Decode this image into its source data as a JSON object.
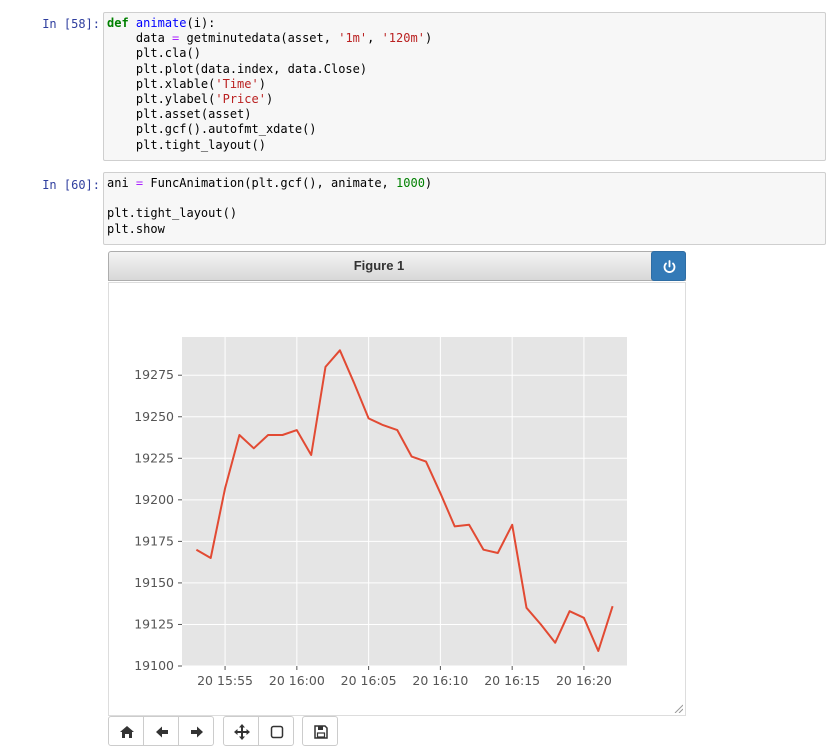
{
  "cell1": {
    "prompt": "In [58]:",
    "code_lines": [
      "def animate(i):",
      "    data = getminutedata(asset, '1m', '120m')",
      "    plt.cla()",
      "    plt.plot(data.index, data.Close)",
      "    plt.xlable('Time')",
      "    plt.ylabel('Price')",
      "    plt.asset(asset)",
      "    plt.gcf().autofmt_xdate()",
      "    plt.tight_layout()"
    ]
  },
  "cell2": {
    "prompt": "In [60]:",
    "code_lines": [
      "ani = FuncAnimation(plt.gcf(), animate, 1000)",
      "",
      "plt.tight_layout()",
      "plt.show"
    ]
  },
  "figure": {
    "title": "Figure 1",
    "power_icon": "power-icon",
    "colors": {
      "line": "#e24a33",
      "axes_bg": "#e5e5e5",
      "grid": "#ffffff",
      "button": "#337ab7"
    }
  },
  "toolbar": {
    "icons": [
      "home-icon",
      "back-arrow-icon",
      "forward-arrow-icon",
      "pan-icon",
      "zoom-rect-icon",
      "save-icon"
    ]
  },
  "chart_data": {
    "type": "line",
    "x": [
      "15:53",
      "15:54",
      "15:55",
      "15:56",
      "15:57",
      "15:58",
      "15:59",
      "16:00",
      "16:01",
      "16:02",
      "16:03",
      "16:04",
      "16:05",
      "16:06",
      "16:07",
      "16:08",
      "16:09",
      "16:10",
      "16:11",
      "16:12",
      "16:13",
      "16:14",
      "16:15",
      "16:16",
      "16:17",
      "16:18",
      "16:19",
      "16:20",
      "16:21",
      "16:22"
    ],
    "values": [
      19170,
      19165,
      19207,
      19239,
      19231,
      19239,
      19239,
      19242,
      19227,
      19280,
      19290,
      19270,
      19249,
      19245,
      19242,
      19226,
      19223,
      19204,
      19184,
      19185,
      19170,
      19168,
      19185,
      19135,
      19125,
      19114,
      19133,
      19129,
      19109,
      19136
    ],
    "x_tick_labels": [
      "20 15:55",
      "20 16:00",
      "20 16:05",
      "20 16:10",
      "20 16:15",
      "20 16:20"
    ],
    "x_tick_positions": [
      "15:55",
      "16:00",
      "16:05",
      "16:10",
      "16:15",
      "16:20"
    ],
    "y_ticks": [
      19100,
      19125,
      19150,
      19175,
      19200,
      19225,
      19250,
      19275
    ],
    "ylim": [
      19100,
      19298
    ],
    "title": "",
    "xlabel": "",
    "ylabel": "",
    "grid": true
  }
}
